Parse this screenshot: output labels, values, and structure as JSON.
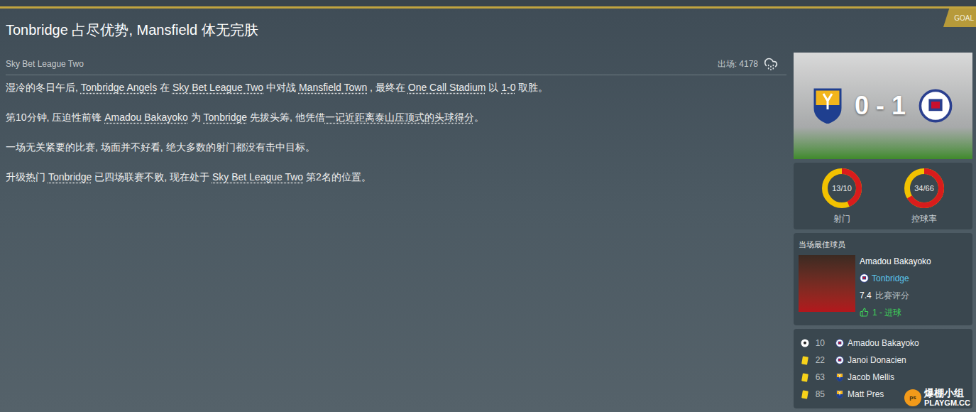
{
  "header": {
    "badge": "GOAL"
  },
  "title": "Tonbridge 占尽优势, Mansfield 体无完肤",
  "competition": "Sky Bet League Two",
  "attendance": "出场: 4178",
  "paragraphs": [
    [
      {
        "text": "湿冷的冬日午后, ",
        "link": false
      },
      {
        "text": "Tonbridge Angels",
        "link": true
      },
      {
        "text": " 在 ",
        "link": false
      },
      {
        "text": "Sky Bet League Two",
        "link": true
      },
      {
        "text": " 中对战 ",
        "link": false
      },
      {
        "text": "Mansfield Town",
        "link": true
      },
      {
        "text": " , 最终在 ",
        "link": false
      },
      {
        "text": "One Call Stadium",
        "link": true
      },
      {
        "text": " 以 ",
        "link": false
      },
      {
        "text": "1-0",
        "link": true
      },
      {
        "text": " 取胜。",
        "link": false
      }
    ],
    [
      {
        "text": "第10分钟, 压迫性前锋 ",
        "link": false
      },
      {
        "text": "Amadou Bakayoko",
        "link": true
      },
      {
        "text": " 为 ",
        "link": false
      },
      {
        "text": "Tonbridge",
        "link": true
      },
      {
        "text": " 先拔头筹, 他凭借",
        "link": false
      },
      {
        "text": "一记近距离泰山压顶式的头球得分",
        "link": true
      },
      {
        "text": "。",
        "link": false
      }
    ],
    [
      {
        "text": "一场无关紧要的比赛, 场面并不好看, 绝大多数的射门都没有击中目标。",
        "link": false
      }
    ],
    [
      {
        "text": "升级热门 ",
        "link": false
      },
      {
        "text": "Tonbridge",
        "link": true
      },
      {
        "text": " 已四场联赛不败, 现在处于 ",
        "link": false
      },
      {
        "text": "Sky Bet League Two",
        "link": true
      },
      {
        "text": " 第2名的位置。",
        "link": false
      }
    ]
  ],
  "score": "0 - 1",
  "stats": [
    {
      "label": "射门",
      "reading": "13/10",
      "home": 13,
      "away": 10
    },
    {
      "label": "控球率",
      "reading": "34/66",
      "home": 34,
      "away": 66
    }
  ],
  "best_player": {
    "heading": "当场最佳球员",
    "name": "Amadou Bakayoko",
    "team": "Tonbridge",
    "rating": "7.4",
    "rating_label": "比赛评分",
    "goals": "1 - 进球"
  },
  "events": [
    {
      "kind": "goal",
      "minute": "10",
      "team": "away",
      "player": "Amadou Bakayoko"
    },
    {
      "kind": "yellow-card",
      "minute": "22",
      "team": "away",
      "player": "Janoi Donacien"
    },
    {
      "kind": "yellow-card",
      "minute": "63",
      "team": "home",
      "player": "Jacob Mellis"
    },
    {
      "kind": "yellow-card",
      "minute": "85",
      "team": "home",
      "player": "Matt Pres"
    }
  ],
  "watermark": {
    "badge": "ps",
    "title": "爆棚小组",
    "site": "PLAYGM.CC"
  }
}
